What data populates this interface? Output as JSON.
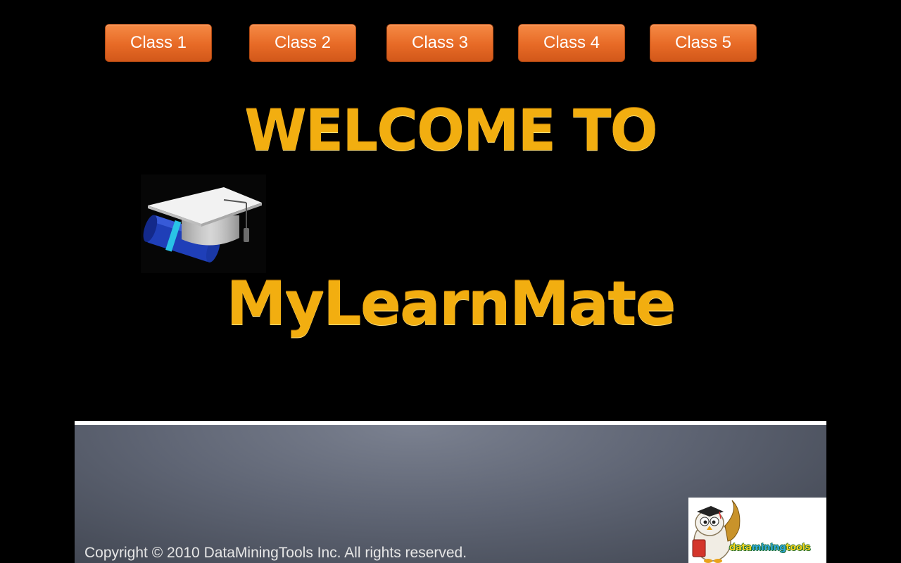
{
  "nav": {
    "buttons": [
      {
        "label": "Class 1"
      },
      {
        "label": "Class 2"
      },
      {
        "label": "Class 3"
      },
      {
        "label": "Class 4"
      },
      {
        "label": "Class 5"
      }
    ]
  },
  "hero": {
    "welcome": "WELCOME TO",
    "brand": "MyLearnMate",
    "icon": "graduation-cap-icon"
  },
  "footer": {
    "copyright": "Copyright © 2010 DataMiningTools Inc. All rights reserved.",
    "logo_prefix": "data",
    "logo_accent": "mining",
    "logo_suffix": "tools"
  },
  "colors": {
    "button": "#e76a26",
    "title_gold": "#f2ae10",
    "background": "#000000",
    "panel": "#5f6574"
  }
}
